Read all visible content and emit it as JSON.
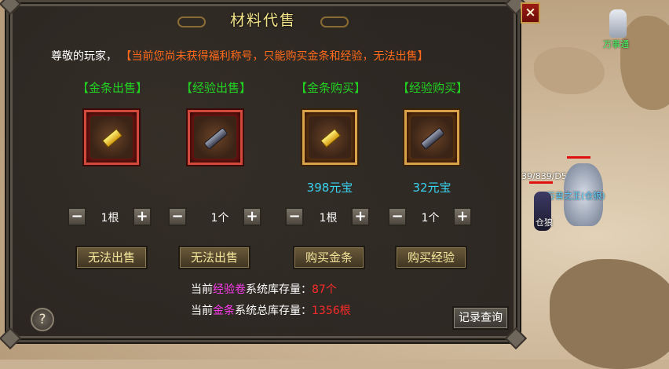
{
  "panel": {
    "title": "材料代售",
    "greeting_prefix": "尊敬的玩家，",
    "greeting_warning": "【当前您尚未获得福利称号，只能购买金条和经验，无法出售】",
    "close_label": "×",
    "help_label": "?",
    "record_button": "记录查询"
  },
  "columns": [
    {
      "title": "【金条出售】",
      "kind": "sell",
      "item": "gold-bar-icon",
      "price": "",
      "qty": "1根",
      "action": "无法出售"
    },
    {
      "title": "【经验出售】",
      "kind": "sell",
      "item": "exp-scroll-icon",
      "price": "",
      "qty": "1个",
      "action": "无法出售"
    },
    {
      "title": "【金条购买】",
      "kind": "buy",
      "item": "gold-bar-icon",
      "price": "398元宝",
      "qty": "1根",
      "action": "购买金条"
    },
    {
      "title": "【经验购买】",
      "kind": "buy",
      "item": "exp-scroll-icon",
      "price": "32元宝",
      "qty": "1个",
      "action": "购买经验"
    }
  ],
  "stock": {
    "exp_prefix": "当前",
    "exp_item": "经验卷",
    "exp_mid": "系统库存量：",
    "exp_value": "87个",
    "gold_prefix": "当前",
    "gold_item": "金条",
    "gold_mid": "系统总库存量：",
    "gold_value": "1356根"
  },
  "world": {
    "npc1_name": "万事通",
    "npc2_hp": "39/839/D53",
    "npc2_name": "万兽之王(仓狼)",
    "npc3_name": "仓狼"
  },
  "colors": {
    "title": "#f2e38a",
    "warning": "#ff6a1a",
    "column_title": "#22d422",
    "price": "#38d4f2",
    "stock_item": "#ff3cf0",
    "stock_value": "#ff2a2a"
  }
}
